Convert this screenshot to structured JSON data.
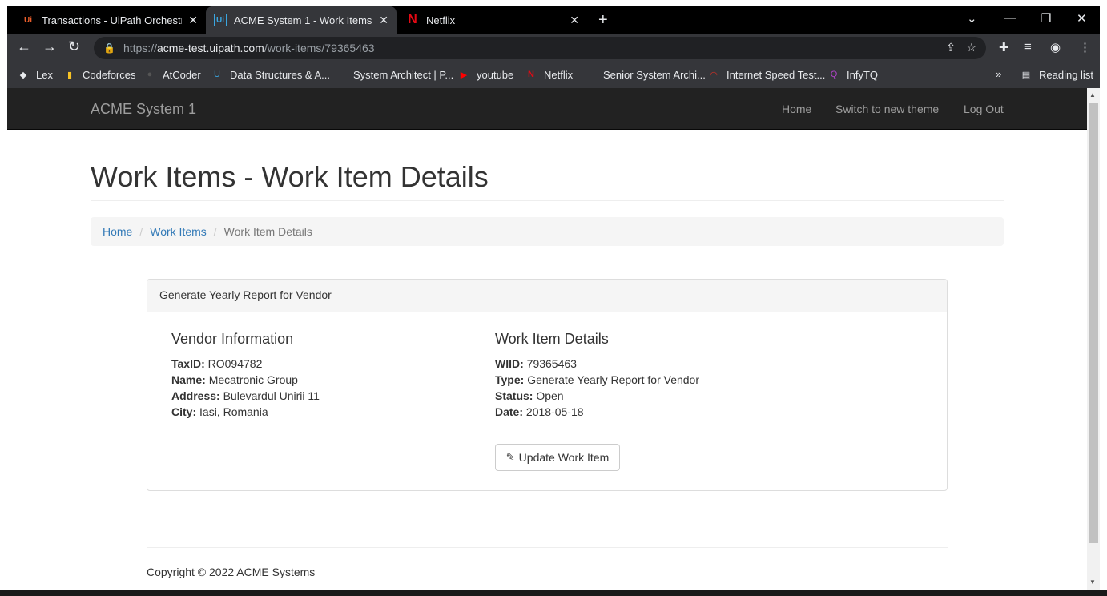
{
  "browser": {
    "tabs": [
      {
        "title": "Transactions - UiPath Orchestrato",
        "icon": "uipath-icon"
      },
      {
        "title": "ACME System 1 - Work Items",
        "icon": "uipath-icon"
      },
      {
        "title": "Netflix",
        "icon": "netflix-icon"
      }
    ],
    "url_scheme": "https://",
    "url_host": "acme-test.uipath.com",
    "url_path": "/work-items/79365463",
    "bookmarks": [
      {
        "label": "Lex"
      },
      {
        "label": "Codeforces"
      },
      {
        "label": "AtCoder"
      },
      {
        "label": "Data Structures & A..."
      },
      {
        "label": "System Architect | P..."
      },
      {
        "label": "youtube"
      },
      {
        "label": "Netflix"
      },
      {
        "label": "Senior System Archi..."
      },
      {
        "label": "Internet Speed Test..."
      },
      {
        "label": "InfyTQ"
      }
    ],
    "overflow": "»",
    "reading_list": "Reading list"
  },
  "navbar": {
    "brand": "ACME System 1",
    "links": [
      {
        "label": "Home"
      },
      {
        "label": "Switch to new theme"
      },
      {
        "label": "Log Out"
      }
    ]
  },
  "page": {
    "title": "Work Items - Work Item Details",
    "breadcrumb": [
      {
        "label": "Home"
      },
      {
        "label": "Work Items"
      },
      {
        "label": "Work Item Details"
      }
    ]
  },
  "panel": {
    "heading": "Generate Yearly Report for Vendor",
    "vendor": {
      "title": "Vendor Information",
      "fields": [
        {
          "label": "TaxID:",
          "value": "RO094782"
        },
        {
          "label": "Name:",
          "value": "Mecatronic Group"
        },
        {
          "label": "Address:",
          "value": "Bulevardul Unirii 11"
        },
        {
          "label": "City:",
          "value": "Iasi, Romania"
        }
      ]
    },
    "details": {
      "title": "Work Item Details",
      "fields": [
        {
          "label": "WIID:",
          "value": "79365463"
        },
        {
          "label": "Type:",
          "value": "Generate Yearly Report for Vendor"
        },
        {
          "label": "Status:",
          "value": "Open"
        },
        {
          "label": "Date:",
          "value": "2018-05-18"
        }
      ]
    },
    "update_button": "Update Work Item"
  },
  "footer": {
    "copyright": "Copyright © 2022 ACME Systems"
  }
}
